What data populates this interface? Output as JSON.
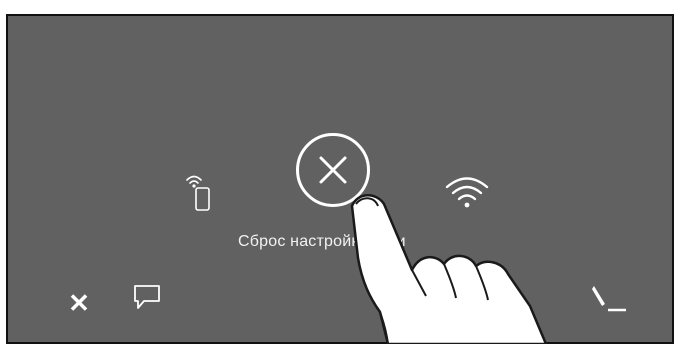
{
  "screen": {
    "background": "#616161",
    "label": "Сброс настройки сети",
    "icons": {
      "phone_wifi": "phone-wifi-icon",
      "cancel": "close-circle-icon",
      "wifi": "wifi-icon",
      "close": "close-x-icon",
      "message": "message-bubble-icon",
      "edit": "edit-pen-icon"
    },
    "close_glyph": "✕"
  }
}
